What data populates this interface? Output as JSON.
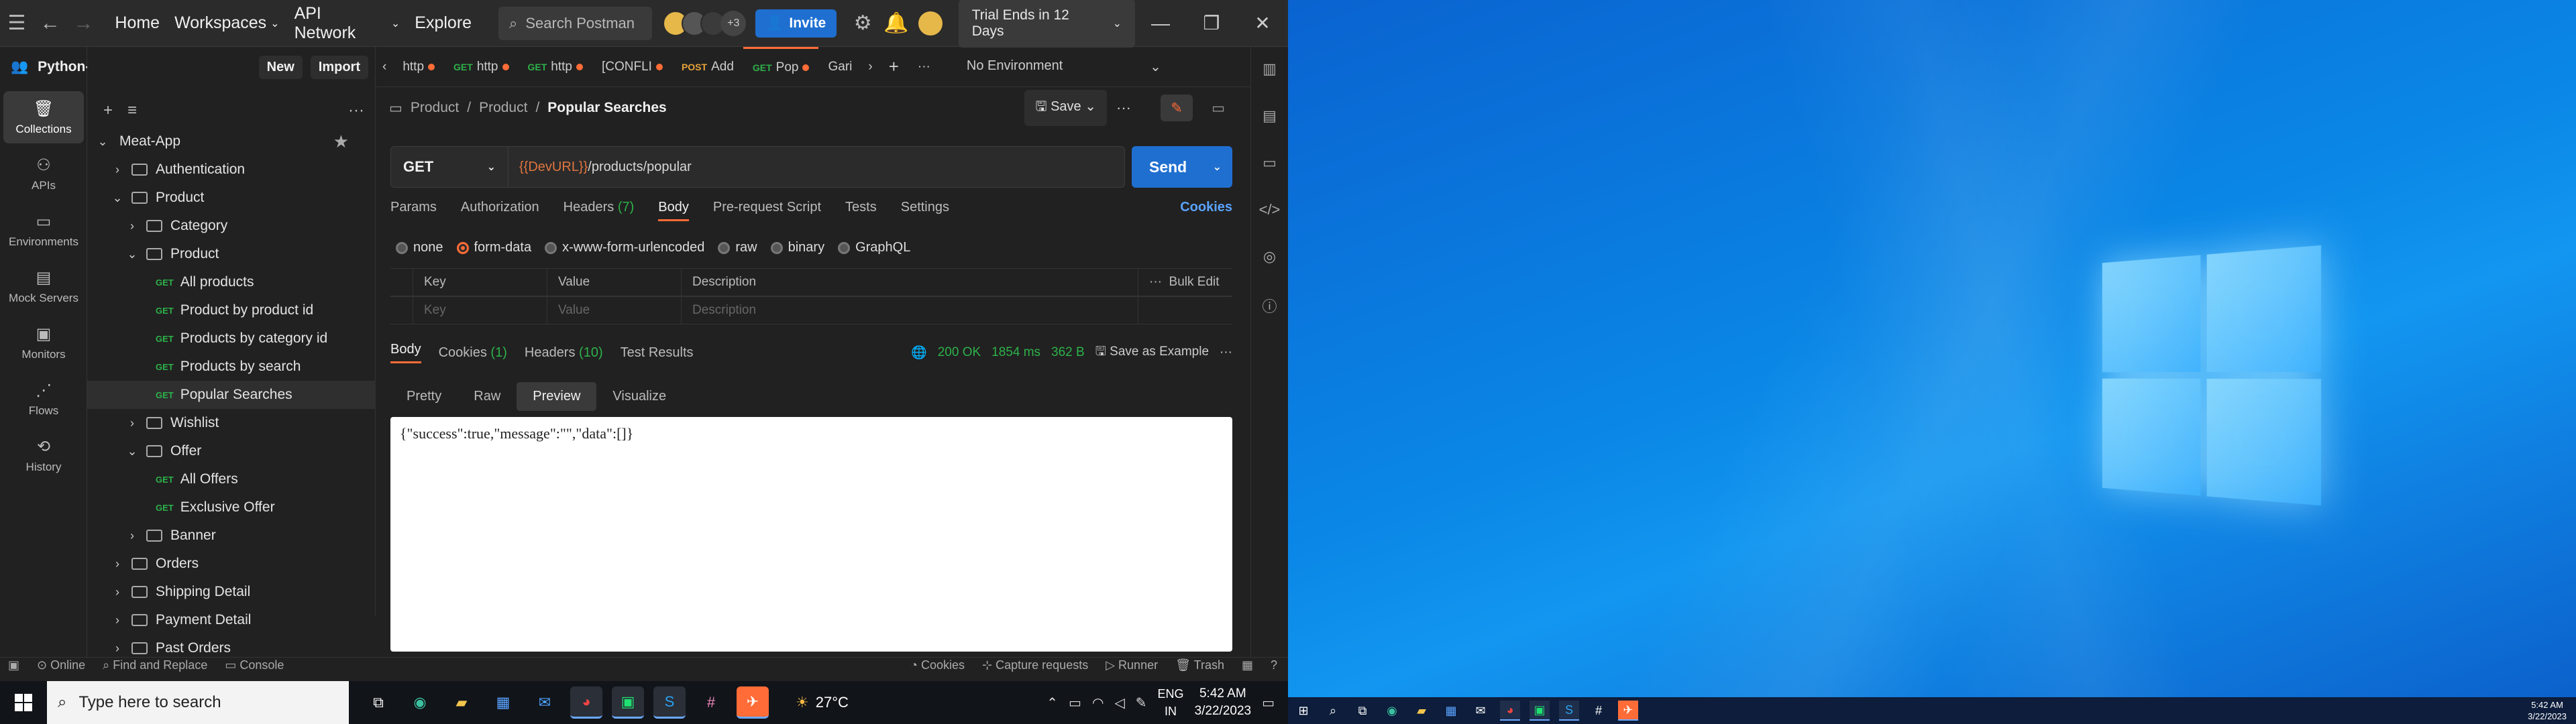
{
  "topbar": {
    "nav": [
      "Home",
      "Workspaces",
      "API Network",
      "Explore"
    ],
    "search_placeholder": "Search Postman",
    "avatars_more": "+3",
    "invite": "Invite",
    "trial": "Trial Ends in 12 Days"
  },
  "workspace": {
    "name": "Python-WorkSpace",
    "new": "New",
    "import": "Import"
  },
  "rail": [
    "Collections",
    "APIs",
    "Environments",
    "Mock Servers",
    "Monitors",
    "Flows",
    "History"
  ],
  "tree": [
    {
      "label": "Meat-App",
      "level": 0,
      "type": "collection",
      "open": true
    },
    {
      "label": "Authentication",
      "level": 1,
      "type": "folder",
      "open": false
    },
    {
      "label": "Product",
      "level": 1,
      "type": "folder",
      "open": true
    },
    {
      "label": "Category",
      "level": 2,
      "type": "folder",
      "open": false
    },
    {
      "label": "Product",
      "level": 2,
      "type": "folder",
      "open": true
    },
    {
      "label": "All products",
      "level": 3,
      "type": "request",
      "method": "GET"
    },
    {
      "label": "Product by product id",
      "level": 3,
      "type": "request",
      "method": "GET"
    },
    {
      "label": "Products by category id",
      "level": 3,
      "type": "request",
      "method": "GET"
    },
    {
      "label": "Products by search",
      "level": 3,
      "type": "request",
      "method": "GET"
    },
    {
      "label": "Popular Searches",
      "level": 3,
      "type": "request",
      "method": "GET",
      "selected": true
    },
    {
      "label": "Wishlist",
      "level": 2,
      "type": "folder",
      "open": false
    },
    {
      "label": "Offer",
      "level": 2,
      "type": "folder",
      "open": true
    },
    {
      "label": "All Offers",
      "level": 3,
      "type": "request",
      "method": "GET"
    },
    {
      "label": "Exclusive Offer",
      "level": 3,
      "type": "request",
      "method": "GET"
    },
    {
      "label": "Banner",
      "level": 2,
      "type": "folder",
      "open": false
    },
    {
      "label": "Orders",
      "level": 1,
      "type": "folder",
      "open": false
    },
    {
      "label": "Shipping Detail",
      "level": 1,
      "type": "folder",
      "open": false
    },
    {
      "label": "Payment Detail",
      "level": 1,
      "type": "folder",
      "open": false
    },
    {
      "label": "Past Orders",
      "level": 1,
      "type": "folder",
      "open": false
    }
  ],
  "tabs": [
    {
      "method": "",
      "label": "http",
      "dirty": true
    },
    {
      "method": "GET",
      "label": "http",
      "dirty": true
    },
    {
      "method": "GET",
      "label": "http",
      "dirty": true
    },
    {
      "method": "",
      "label": "[CONFLI",
      "dirty": true
    },
    {
      "method": "POST",
      "label": "Add",
      "dirty": false
    },
    {
      "method": "GET",
      "label": "Pop",
      "dirty": true,
      "active": true
    },
    {
      "method": "",
      "label": "Gari",
      "dirty": false
    }
  ],
  "environment": "No Environment",
  "breadcrumb": [
    "Product",
    "Product",
    "Popular Searches"
  ],
  "save": "Save",
  "request": {
    "method": "GET",
    "url_var": "{{DevURL}}",
    "url_path": "/products/popular",
    "send": "Send"
  },
  "req_tabs": {
    "params": "Params",
    "authorization": "Authorization",
    "headers": "Headers",
    "headers_count": "(7)",
    "body": "Body",
    "prerequest": "Pre-request Script",
    "tests": "Tests",
    "settings": "Settings",
    "cookies": "Cookies"
  },
  "body_types": [
    "none",
    "form-data",
    "x-www-form-urlencoded",
    "raw",
    "binary",
    "GraphQL"
  ],
  "body_type_selected": "form-data",
  "kv": {
    "key": "Key",
    "value": "Value",
    "description": "Description",
    "bulk": "Bulk Edit"
  },
  "response": {
    "body": "Body",
    "cookies": "Cookies",
    "cookies_count": "(1)",
    "headers": "Headers",
    "headers_count": "(10)",
    "tests": "Test Results",
    "status": "200 OK",
    "time": "1854 ms",
    "size": "362 B",
    "save_example": "Save as Example",
    "views": [
      "Pretty",
      "Raw",
      "Preview",
      "Visualize"
    ],
    "view_selected": "Preview",
    "content": "{\"success\":true,\"message\":\"\",\"data\":[]}"
  },
  "statusbar": {
    "online": "Online",
    "find": "Find and Replace",
    "console": "Console",
    "cookies": "Cookies",
    "capture": "Capture requests",
    "runner": "Runner",
    "trash": "Trash"
  },
  "taskbar": {
    "search_placeholder": "Type here to search",
    "temperature": "27°C",
    "lang1": "ENG",
    "lang2": "IN",
    "time": "5:42 AM",
    "date": "3/22/2023"
  },
  "taskbar2": {
    "time": "5:42 AM",
    "date": "3/22/2023"
  },
  "colors": {
    "accent": "#ff6c37",
    "send": "#1f6fd1",
    "get": "#2db24a",
    "status_ok": "#2db24a"
  }
}
